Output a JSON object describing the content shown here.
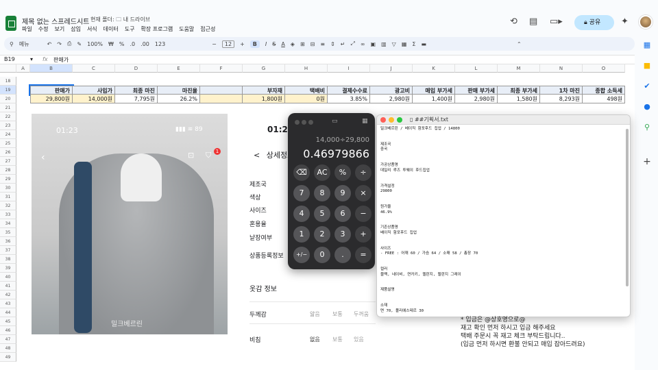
{
  "app": {
    "title": "제목 없는 스프레드시트",
    "folder_prefix": "현재 폴더:",
    "folder_name": "내 드라이브",
    "menus": [
      "파일",
      "수정",
      "보기",
      "삽입",
      "서식",
      "데이터",
      "도구",
      "확장 프로그램",
      "도움말",
      "접근성"
    ],
    "share_label": "공유"
  },
  "toolbar": {
    "menu_label": "메뉴",
    "zoom": "100%",
    "currency": "₩",
    "percent": "%",
    "decimal_dec": ".0",
    "decimal_inc": ".00",
    "number_format": "123",
    "font_size": "12",
    "bold": "B",
    "italic": "I",
    "strike": "S",
    "text_color": "A"
  },
  "formula_bar": {
    "cell_ref": "B19",
    "fx": "fx",
    "content": "판매가"
  },
  "columns": [
    "A",
    "B",
    "C",
    "D",
    "E",
    "F",
    "G",
    "H",
    "I",
    "J",
    "K",
    "L",
    "M",
    "N",
    "O"
  ],
  "rows": [
    "18",
    "19",
    "20",
    "21",
    "22",
    "23",
    "24",
    "25",
    "26",
    "27",
    "28",
    "29",
    "30",
    "31",
    "32",
    "33",
    "34",
    "35",
    "36",
    "37",
    "38",
    "39",
    "40",
    "41",
    "42",
    "43",
    "44",
    "45",
    "46",
    "47",
    "48",
    "49"
  ],
  "sheet": {
    "headers_left": [
      "판매가",
      "사입가",
      "최종 마진",
      "마진율"
    ],
    "values_left": [
      "29,800원",
      "14,000원",
      "7,795원",
      "26.2%"
    ],
    "headers_right": [
      "부자재",
      "택배비",
      "결제수수료",
      "광고비",
      "매입 부가세",
      "판매 부가세",
      "최종 부가세",
      "1차 마진",
      "종합 소득세"
    ],
    "values_right": [
      "1,800원",
      "0원",
      "3.85%",
      "2,980원",
      "1,400원",
      "2,980원",
      "1,580원",
      "8,293원",
      "498원"
    ]
  },
  "phone": {
    "time": "01:23",
    "status": "89",
    "cart_badge": "1",
    "watermark": "밀크베르린"
  },
  "detail": {
    "time": "01:23",
    "back": "<",
    "title": "상세정보",
    "labels": [
      "제조국",
      "색상",
      "사이즈",
      "혼용율",
      "낱장여부",
      "상품등록정보"
    ],
    "section": "옷감 정보",
    "thickness_label": "두께감",
    "thickness_opts": [
      "얇음",
      "보통",
      "두꺼움"
    ],
    "sheer_label": "비침",
    "sheer_opts": [
      "없음",
      "보통",
      "있음"
    ]
  },
  "calculator": {
    "expression": "14,000÷29,800",
    "result": "0.46979866",
    "keys": [
      "⌫",
      "AC",
      "%",
      "÷",
      "7",
      "8",
      "9",
      "×",
      "4",
      "5",
      "6",
      "−",
      "1",
      "2",
      "3",
      "+",
      "+/−",
      "0",
      ".",
      "="
    ]
  },
  "text_window": {
    "filename": "##기획서.txt",
    "body": "밀크베르린 / 베이직 함포후드 집업 / 14800\n\n\n제조국\n중국\n\n\n가공상품명\n데일리 루즈 투웨이 후드집업\n\n\n가격설정\n29800\n\n\n원가율\n46.9%\n\n\n기존상품명\n베이직 함포후드 집업\n\n\n사이즈\n- FREE : 어깨 60 / 가슴 64 / 소매 58 / 총장 70\n\n\n컬러\n블랙, 네이비, 연카키, 멜란지, 멜란지 그레이\n\n\n제품설명\n\n\n소재\n면 70, 폴리에스테르 30"
  },
  "notice": {
    "line1": "* 입금은 @상호명으로@",
    "line2": "재고 확인 먼저 하시고 입금 해주세요",
    "line3": "택배 주문시 꼭 재고 체크 부탁드립니다..",
    "line4": "(입금 먼저 하시면 환불 안되고 매입 잡아드려요)"
  },
  "colors": {
    "header_fill": "#e8eef7",
    "value_fill": "#fff2cc",
    "share_fill": "#c2e7ff",
    "sheets_green": "#188038"
  }
}
